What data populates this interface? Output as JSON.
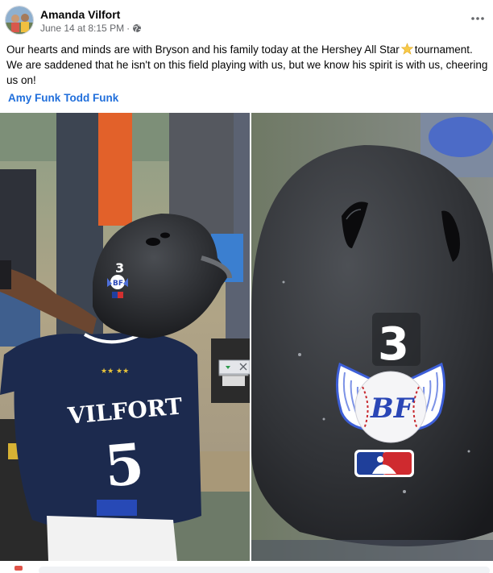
{
  "post": {
    "author": "Amanda Vilfort",
    "date": "June 14 at 8:15 PM",
    "separator": "·",
    "privacy_icon": "globe-icon",
    "more_icon": "ellipsis-icon",
    "text_part1": "Our hearts and minds are with Bryson and his family today at the Hershey All Star",
    "text_part2": "tournament. We are saddened that he isn't on this field playing with us, but we know his spirit is with us, cheering us on!",
    "emoji": "star-emoji",
    "tags": [
      "Amy Funk",
      "Todd Funk"
    ]
  },
  "photos": {
    "left": {
      "jersey_name": "VILFORT",
      "jersey_number": "5",
      "helmet_number": "3",
      "sticker_text": "BF"
    },
    "right": {
      "helmet_number": "3",
      "sticker_text": "BF"
    }
  },
  "colors": {
    "link": "#216fdb",
    "meta": "#65676b",
    "jersey": "#1c2a4e",
    "helmet": "#2a2c30"
  }
}
